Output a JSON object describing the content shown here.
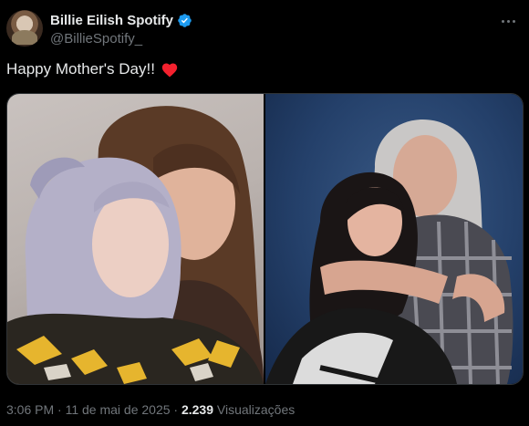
{
  "author": {
    "display_name": "Billie Eilish Spotify",
    "handle": "@BillieSpotify_",
    "verified": true,
    "avatar_icon": "profile-photo"
  },
  "tweet": {
    "text": "Happy Mother's Day!!",
    "emoji": "red-heart-icon"
  },
  "media": {
    "photo_count": 2
  },
  "meta": {
    "timestamp": "3:06 PM · 11 de mai de 2025 · ",
    "views_count": "2.239",
    "views_label": " Visualizações"
  },
  "colors": {
    "background": "#000000",
    "text": "#e7e9ea",
    "muted": "#71767b",
    "verified": "#1d9bf0",
    "heart": "#f91880"
  }
}
